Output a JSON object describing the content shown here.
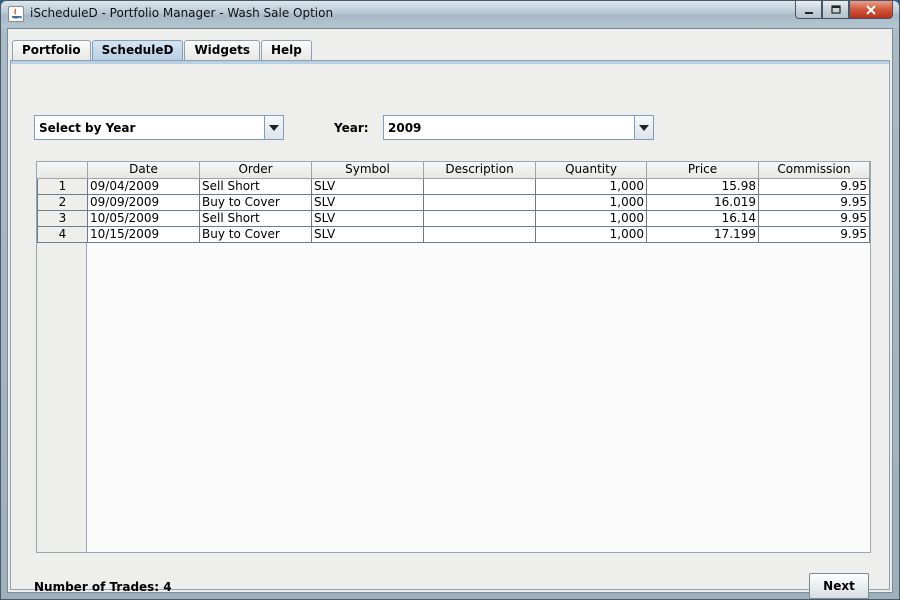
{
  "window": {
    "title": "iScheduleD - Portfolio Manager - Wash Sale Option"
  },
  "tabs": [
    {
      "label": "Portfolio",
      "active": false
    },
    {
      "label": "ScheduleD",
      "active": true
    },
    {
      "label": "Widgets",
      "active": false
    },
    {
      "label": "Help",
      "active": false
    }
  ],
  "filter": {
    "mode_value": "Select by Year",
    "year_label": "Year:",
    "year_value": "2009"
  },
  "table": {
    "columns": [
      "Date",
      "Order",
      "Symbol",
      "Description",
      "Quantity",
      "Price",
      "Commission"
    ],
    "rows": [
      {
        "n": "1",
        "date": "09/04/2009",
        "order": "Sell Short",
        "symbol": "SLV",
        "description": "",
        "quantity": "1,000",
        "price": "15.98",
        "commission": "9.95"
      },
      {
        "n": "2",
        "date": "09/09/2009",
        "order": "Buy to Cover",
        "symbol": "SLV",
        "description": "",
        "quantity": "1,000",
        "price": "16.019",
        "commission": "9.95"
      },
      {
        "n": "3",
        "date": "10/05/2009",
        "order": "Sell Short",
        "symbol": "SLV",
        "description": "",
        "quantity": "1,000",
        "price": "16.14",
        "commission": "9.95"
      },
      {
        "n": "4",
        "date": "10/15/2009",
        "order": "Buy to Cover",
        "symbol": "SLV",
        "description": "",
        "quantity": "1,000",
        "price": "17.199",
        "commission": "9.95"
      }
    ]
  },
  "footer": {
    "trades_label": "Number of Trades: 4",
    "next_label": "Next"
  },
  "colors": {
    "active_tab": "#b8cfe4",
    "combo_border": "#7f9db9",
    "close_button": "#d0573b"
  }
}
